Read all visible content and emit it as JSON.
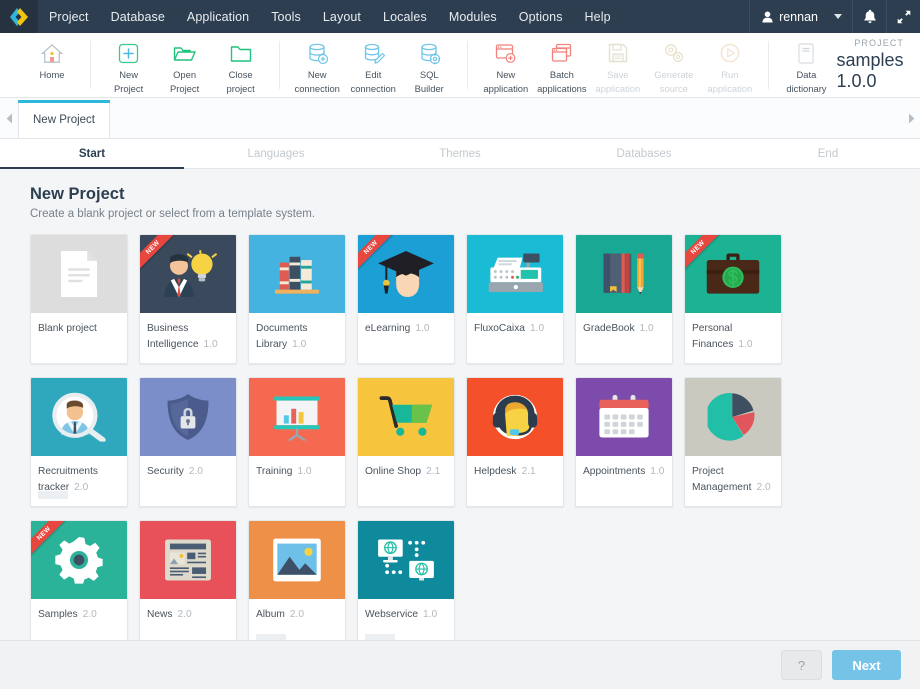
{
  "menu": {
    "logo": "logo-icon",
    "items": [
      "Project",
      "Database",
      "Application",
      "Tools",
      "Layout",
      "Locales",
      "Modules",
      "Options",
      "Help"
    ],
    "user": "rennan",
    "bell": "bell-icon",
    "expand": "expand-icon"
  },
  "toolbar": {
    "groups": [
      [
        {
          "label1": "Home",
          "label2": "",
          "icon": "home-icon",
          "disabled": false
        }
      ],
      [
        {
          "label1": "New",
          "label2": "Project",
          "icon": "new-project-icon",
          "disabled": false
        },
        {
          "label1": "Open",
          "label2": "Project",
          "icon": "open-project-icon",
          "disabled": false
        },
        {
          "label1": "Close",
          "label2": "project",
          "icon": "close-project-icon",
          "disabled": false
        }
      ],
      [
        {
          "label1": "New",
          "label2": "connection",
          "icon": "new-connection-icon",
          "disabled": false
        },
        {
          "label1": "Edit",
          "label2": "connection",
          "icon": "edit-connection-icon",
          "disabled": false
        },
        {
          "label1": "SQL",
          "label2": "Builder",
          "icon": "sql-builder-icon",
          "disabled": false
        }
      ],
      [
        {
          "label1": "New",
          "label2": "application",
          "icon": "new-application-icon",
          "disabled": false
        },
        {
          "label1": "Batch",
          "label2": "applications",
          "icon": "batch-applications-icon",
          "disabled": false
        },
        {
          "label1": "Save",
          "label2": "application",
          "icon": "save-application-icon",
          "disabled": true
        },
        {
          "label1": "Generate",
          "label2": "source",
          "icon": "generate-source-icon",
          "disabled": true
        },
        {
          "label1": "Run",
          "label2": "application",
          "icon": "run-application-icon",
          "disabled": true
        }
      ],
      [
        {
          "label1": "Data",
          "label2": "dictionary",
          "icon": "data-dictionary-icon",
          "disabled": false
        }
      ]
    ],
    "project_kicker": "PROJECT",
    "project_name": "samples 1.0.0"
  },
  "tabs": {
    "left_arrow": "chevron-left-icon",
    "right_arrow": "chevron-right-icon",
    "items": [
      {
        "label": "New Project",
        "active": true
      }
    ]
  },
  "steps": [
    {
      "label": "Start",
      "active": true
    },
    {
      "label": "Languages",
      "active": false
    },
    {
      "label": "Themes",
      "active": false
    },
    {
      "label": "Databases",
      "active": false
    },
    {
      "label": "End",
      "active": false
    }
  ],
  "page": {
    "title": "New Project",
    "subtitle": "Create a blank project or select from a template system."
  },
  "templates": [
    {
      "name": "Blank project",
      "version": "",
      "new": false,
      "icon": "blank-document-icon",
      "bg": "#dddddd",
      "placeholder": false
    },
    {
      "name": "Business Intelligence",
      "version": "1.0",
      "new": true,
      "icon": "businessman-idea-icon",
      "bg": "#3a4a5c",
      "placeholder": false
    },
    {
      "name": "Documents Library",
      "version": "1.0",
      "new": false,
      "icon": "books-icon",
      "bg": "#44b3e0",
      "placeholder": false
    },
    {
      "name": "eLearning",
      "version": "1.0",
      "new": true,
      "icon": "graduate-cap-icon",
      "bg": "#1c9fd4",
      "placeholder": false
    },
    {
      "name": "FluxoCaixa",
      "version": "1.0",
      "new": false,
      "icon": "cash-register-icon",
      "bg": "#19bcd4",
      "placeholder": false
    },
    {
      "name": "GradeBook",
      "version": "1.0",
      "new": false,
      "icon": "notebook-pencil-icon",
      "bg": "#18a894",
      "placeholder": false
    },
    {
      "name": "Personal Finances",
      "version": "1.0",
      "new": true,
      "icon": "money-briefcase-icon",
      "bg": "#1cb394",
      "placeholder": false
    },
    {
      "name": "Recruitments tracker",
      "version": "2.0",
      "new": false,
      "icon": "magnifier-person-icon",
      "bg": "#2fa8bd",
      "placeholder": true
    },
    {
      "name": "Security",
      "version": "2.0",
      "new": false,
      "icon": "shield-lock-icon",
      "bg": "#7b8ec9",
      "placeholder": false
    },
    {
      "name": "Training",
      "version": "1.0",
      "new": false,
      "icon": "presentation-chart-icon",
      "bg": "#f4694f",
      "placeholder": false
    },
    {
      "name": "Online Shop",
      "version": "2.1",
      "new": false,
      "icon": "shopping-cart-icon",
      "bg": "#f7c53d",
      "placeholder": false
    },
    {
      "name": "Helpdesk",
      "version": "2.1",
      "new": false,
      "icon": "headset-support-icon",
      "bg": "#f4502a",
      "placeholder": false
    },
    {
      "name": "Appointments",
      "version": "1.0",
      "new": false,
      "icon": "calendar-icon",
      "bg": "#7c4bac",
      "placeholder": false
    },
    {
      "name": "Project Management",
      "version": "2.0",
      "new": false,
      "icon": "pie-chart-icon",
      "bg": "#c9c9bf",
      "placeholder": false
    },
    {
      "name": "Samples",
      "version": "2.0",
      "new": true,
      "icon": "gear-icon",
      "bg": "#2bb39a",
      "placeholder": false
    },
    {
      "name": "News",
      "version": "2.0",
      "new": false,
      "icon": "newspaper-icon",
      "bg": "#e8515a",
      "placeholder": false
    },
    {
      "name": "Album",
      "version": "2.0",
      "new": false,
      "icon": "photo-icon",
      "bg": "#ef9048",
      "placeholder": true
    },
    {
      "name": "Webservice",
      "version": "1.0",
      "new": false,
      "icon": "network-monitors-icon",
      "bg": "#0f8a9c",
      "placeholder": true
    }
  ],
  "ribbon_label": "NEW",
  "footer": {
    "help_label": "?",
    "next_label": "Next"
  },
  "colors": {
    "menubar": "#2c3e50",
    "accent": "#2fb6db",
    "next_button": "#76c3e8",
    "ribbon": "#e8473f"
  }
}
